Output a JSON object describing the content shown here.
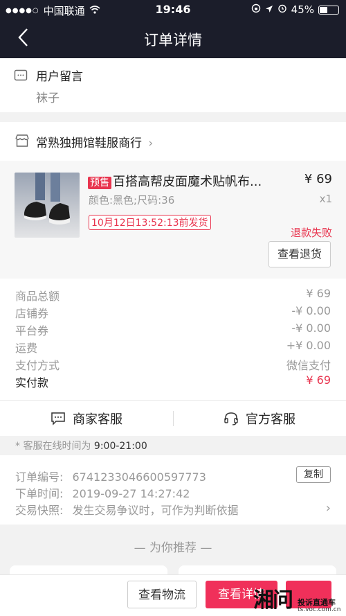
{
  "status_bar": {
    "carrier": "中国联通",
    "time": "19:46",
    "battery": "45%",
    "battery_level": 0.45
  },
  "nav": {
    "back_icon": "chevron-left-icon",
    "title": "订单详情"
  },
  "memo": {
    "label": "用户留言",
    "text": "袜子"
  },
  "shop": {
    "name": "常熟独拥馆鞋服商行"
  },
  "product": {
    "presale_tag": "预售",
    "title": "百搭高帮皮面魔术贴帆布...",
    "price": "¥ 69",
    "spec": "颜色:黑色;尺码:36",
    "quantity": "x1",
    "ship_tag": "10月12日13:52:13前发货",
    "refund_status": "退款失败",
    "refund_button": "查看退货"
  },
  "summary": {
    "rows": [
      {
        "label": "商品总额",
        "value": "¥ 69"
      },
      {
        "label": "店铺券",
        "value": "-¥ 0.00"
      },
      {
        "label": "平台券",
        "value": "-¥ 0.00"
      },
      {
        "label": "运费",
        "value": "+¥ 0.00"
      },
      {
        "label": "支付方式",
        "value": "微信支付"
      }
    ],
    "paid_label": "实付款",
    "paid_value": "¥ 69"
  },
  "service": {
    "merchant": "商家客服",
    "official": "官方客服",
    "hours_label": "* 客服在线时间为",
    "hours_value": "9:00-21:00"
  },
  "order_info": {
    "order_no_label": "订单编号:",
    "order_no": "6741233046600597773",
    "copy_button": "复制",
    "time_label": "下单时间:",
    "time": "2019-09-27 14:27:42",
    "snapshot_label": "交易快照:",
    "snapshot_text": "发生交易争议时，可作为判断依据"
  },
  "recommend": {
    "title": "— 为你推荐 —"
  },
  "bottom_bar": {
    "logistics": "查看物流",
    "detail": "查看详情",
    "extra": ""
  },
  "watermark": {
    "logo": "湘问",
    "line1": "投诉直通车",
    "line2": "ts.voc.com.cn"
  },
  "colors": {
    "nav_bg": "#1b1d2a",
    "accent": "#e8344e",
    "button_pink": "#f0305a"
  }
}
